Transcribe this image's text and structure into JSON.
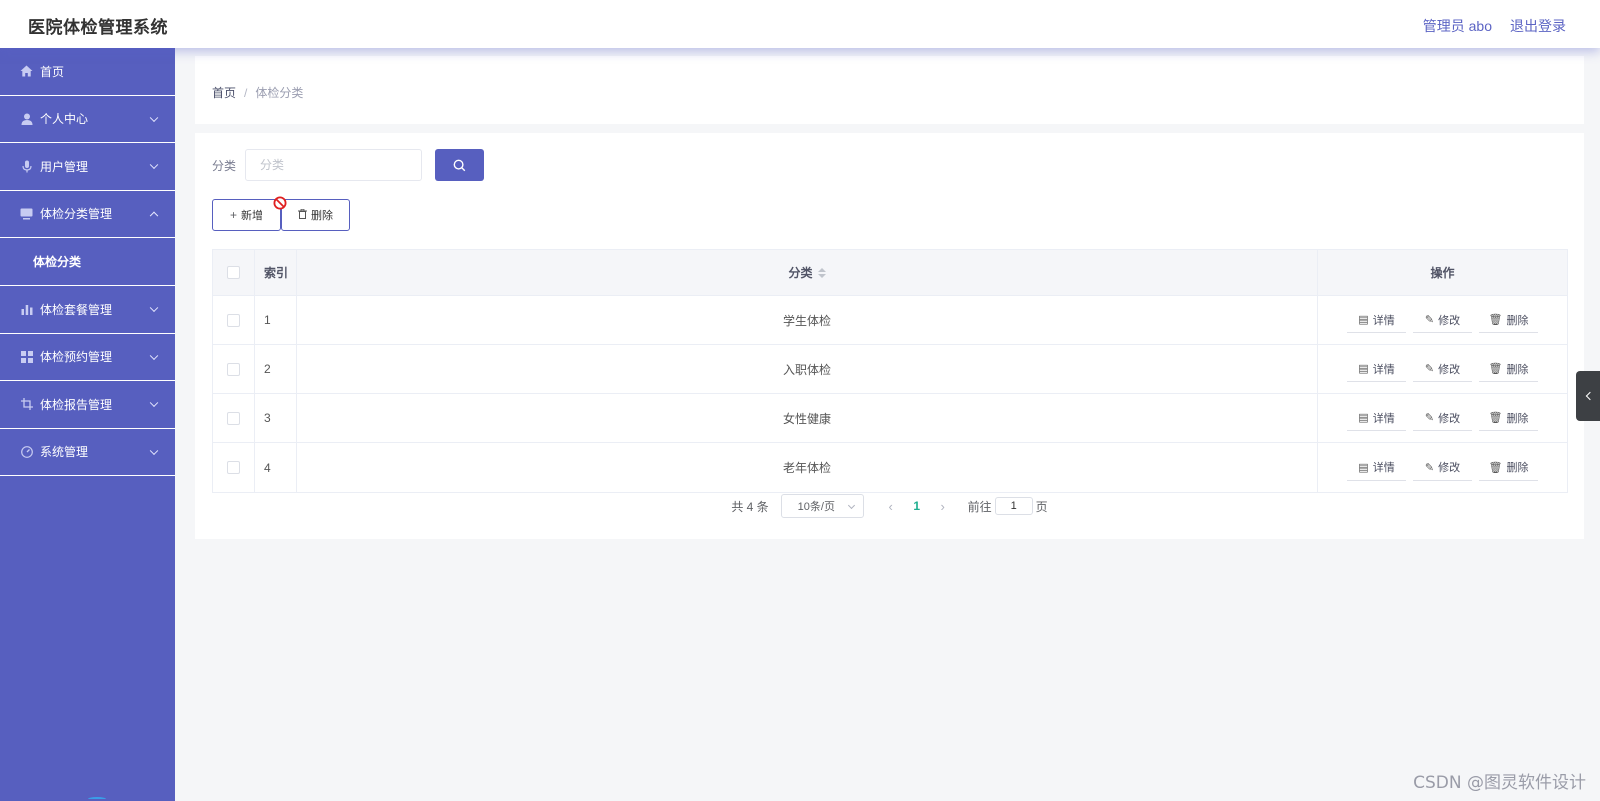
{
  "header": {
    "app_title": "医院体检管理系统",
    "user_label": "管理员 abo",
    "logout_label": "退出登录"
  },
  "sidebar": {
    "items": [
      {
        "label": "首页",
        "icon": "home-icon"
      },
      {
        "label": "个人中心",
        "icon": "user-icon"
      },
      {
        "label": "用户管理",
        "icon": "microphone-icon"
      },
      {
        "label": "体检分类管理",
        "icon": "monitor-icon",
        "expanded": true
      },
      {
        "label": "体检套餐管理",
        "icon": "bar-chart-icon"
      },
      {
        "label": "体检预约管理",
        "icon": "grid-icon"
      },
      {
        "label": "体检报告管理",
        "icon": "crop-icon"
      },
      {
        "label": "系统管理",
        "icon": "gauge-icon"
      }
    ],
    "subitems": [
      {
        "label": "体检分类"
      }
    ],
    "colors": {
      "background": "#575fbf",
      "text": "#ffffff"
    }
  },
  "breadcrumb": {
    "home": "首页",
    "separator": "/",
    "current": "体检分类"
  },
  "filter": {
    "label": "分类",
    "value": "",
    "placeholder": "分类",
    "search_icon": "search-icon"
  },
  "toolbar": {
    "add_label": "新增",
    "add_glyph": "+",
    "delete_label": "删除",
    "delete_glyph": "🗑"
  },
  "table": {
    "columns": {
      "index": "索引",
      "category": "分类",
      "operations": "操作"
    },
    "rows": [
      {
        "index": "1",
        "category": "学生体检"
      },
      {
        "index": "2",
        "category": "入职体检"
      },
      {
        "index": "3",
        "category": "女性健康"
      },
      {
        "index": "4",
        "category": "老年体检"
      }
    ],
    "row_actions": {
      "detail": "详情",
      "edit": "修改",
      "delete": "删除"
    }
  },
  "pagination": {
    "total_text": "共 4 条",
    "page_size": "10条/页",
    "current_page": "1",
    "jump_prefix": "前往",
    "jump_value": "1",
    "jump_suffix": "页"
  },
  "watermark": "CSDN @图灵软件设计",
  "colors": {
    "accent": "#575fbf",
    "page_active": "#1fae8f",
    "background": "#f5f6f8"
  }
}
